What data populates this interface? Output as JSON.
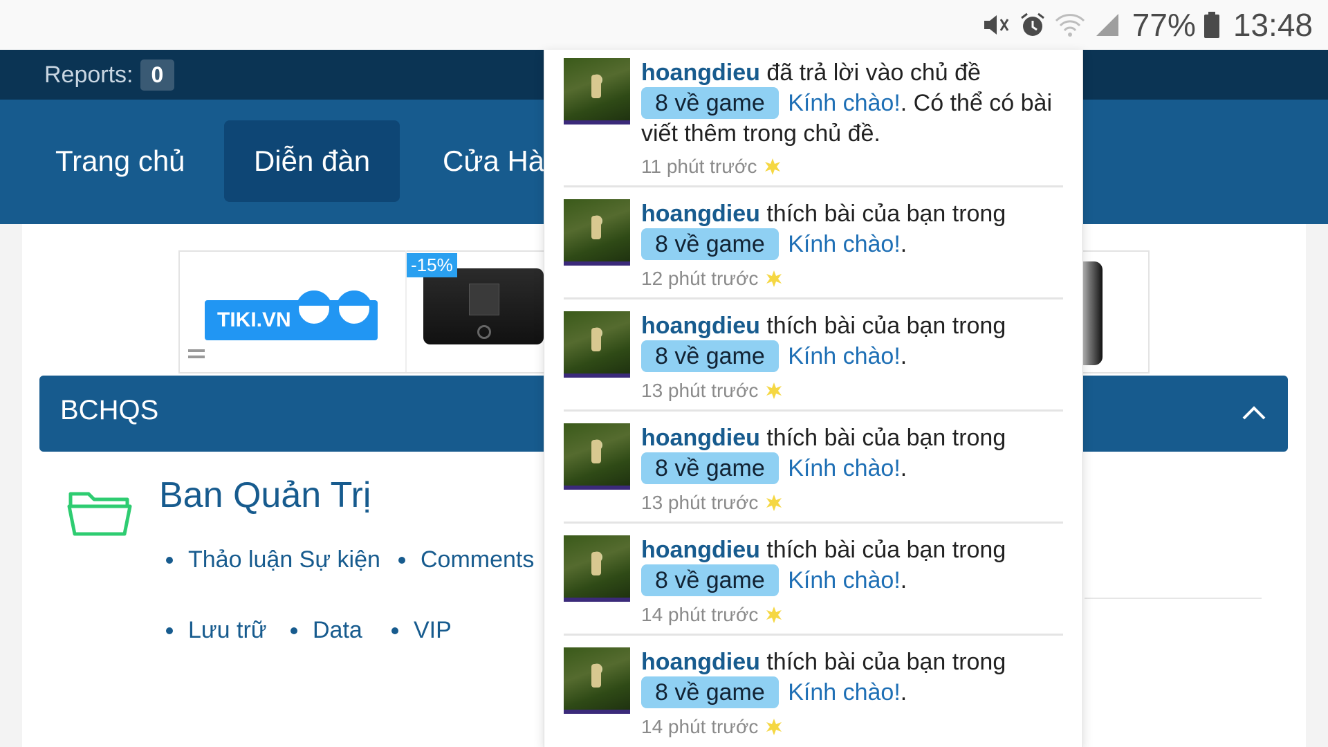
{
  "status_bar": {
    "battery_percent": "77%",
    "time": "13:48",
    "icons": [
      "mute-icon",
      "alarm-icon",
      "wifi-icon",
      "signal-icon",
      "battery-icon"
    ]
  },
  "topbar": {
    "reports_label": "Reports:",
    "reports_count": "0"
  },
  "nav": {
    "tabs": [
      {
        "label": "Trang chủ"
      },
      {
        "label": "Diễn đàn"
      },
      {
        "label": "Cửa Hàng"
      }
    ]
  },
  "ad": {
    "brand": "TIKI.VN",
    "discount": "-15%"
  },
  "section": {
    "title": "BCHQS"
  },
  "forum_node": {
    "title": "Ban Quản Trị",
    "subforums": [
      "Thảo luận Sự kiện",
      "Comments",
      "Lưu trữ",
      "Data",
      "VIP"
    ]
  },
  "notifications": [
    {
      "user": "hoangdieu",
      "action": "đã trả lời vào chủ đề",
      "tag": "8 về game",
      "thread": "Kính chào!",
      "suffix": ". Có thể có bài viết thêm trong chủ đề.",
      "time": "11 phút trước"
    },
    {
      "user": "hoangdieu",
      "action": "thích bài của bạn trong",
      "tag": "8 về game",
      "thread": "Kính chào!",
      "suffix": ".",
      "time": "12 phút trước"
    },
    {
      "user": "hoangdieu",
      "action": "thích bài của bạn trong",
      "tag": "8 về game",
      "thread": "Kính chào!",
      "suffix": ".",
      "time": "13 phút trước"
    },
    {
      "user": "hoangdieu",
      "action": "thích bài của bạn trong",
      "tag": "8 về game",
      "thread": "Kính chào!",
      "suffix": ".",
      "time": "13 phút trước"
    },
    {
      "user": "hoangdieu",
      "action": "thích bài của bạn trong",
      "tag": "8 về game",
      "thread": "Kính chào!",
      "suffix": ".",
      "time": "14 phút trước"
    },
    {
      "user": "hoangdieu",
      "action": "thích bài của bạn trong",
      "tag": "8 về game",
      "thread": "Kính chào!",
      "suffix": ".",
      "time": "14 phút trước"
    }
  ],
  "colors": {
    "topbar": "#0b3454",
    "nav": "#175b8e",
    "tag": "#8fd0f3",
    "link": "#1e6fb5"
  }
}
